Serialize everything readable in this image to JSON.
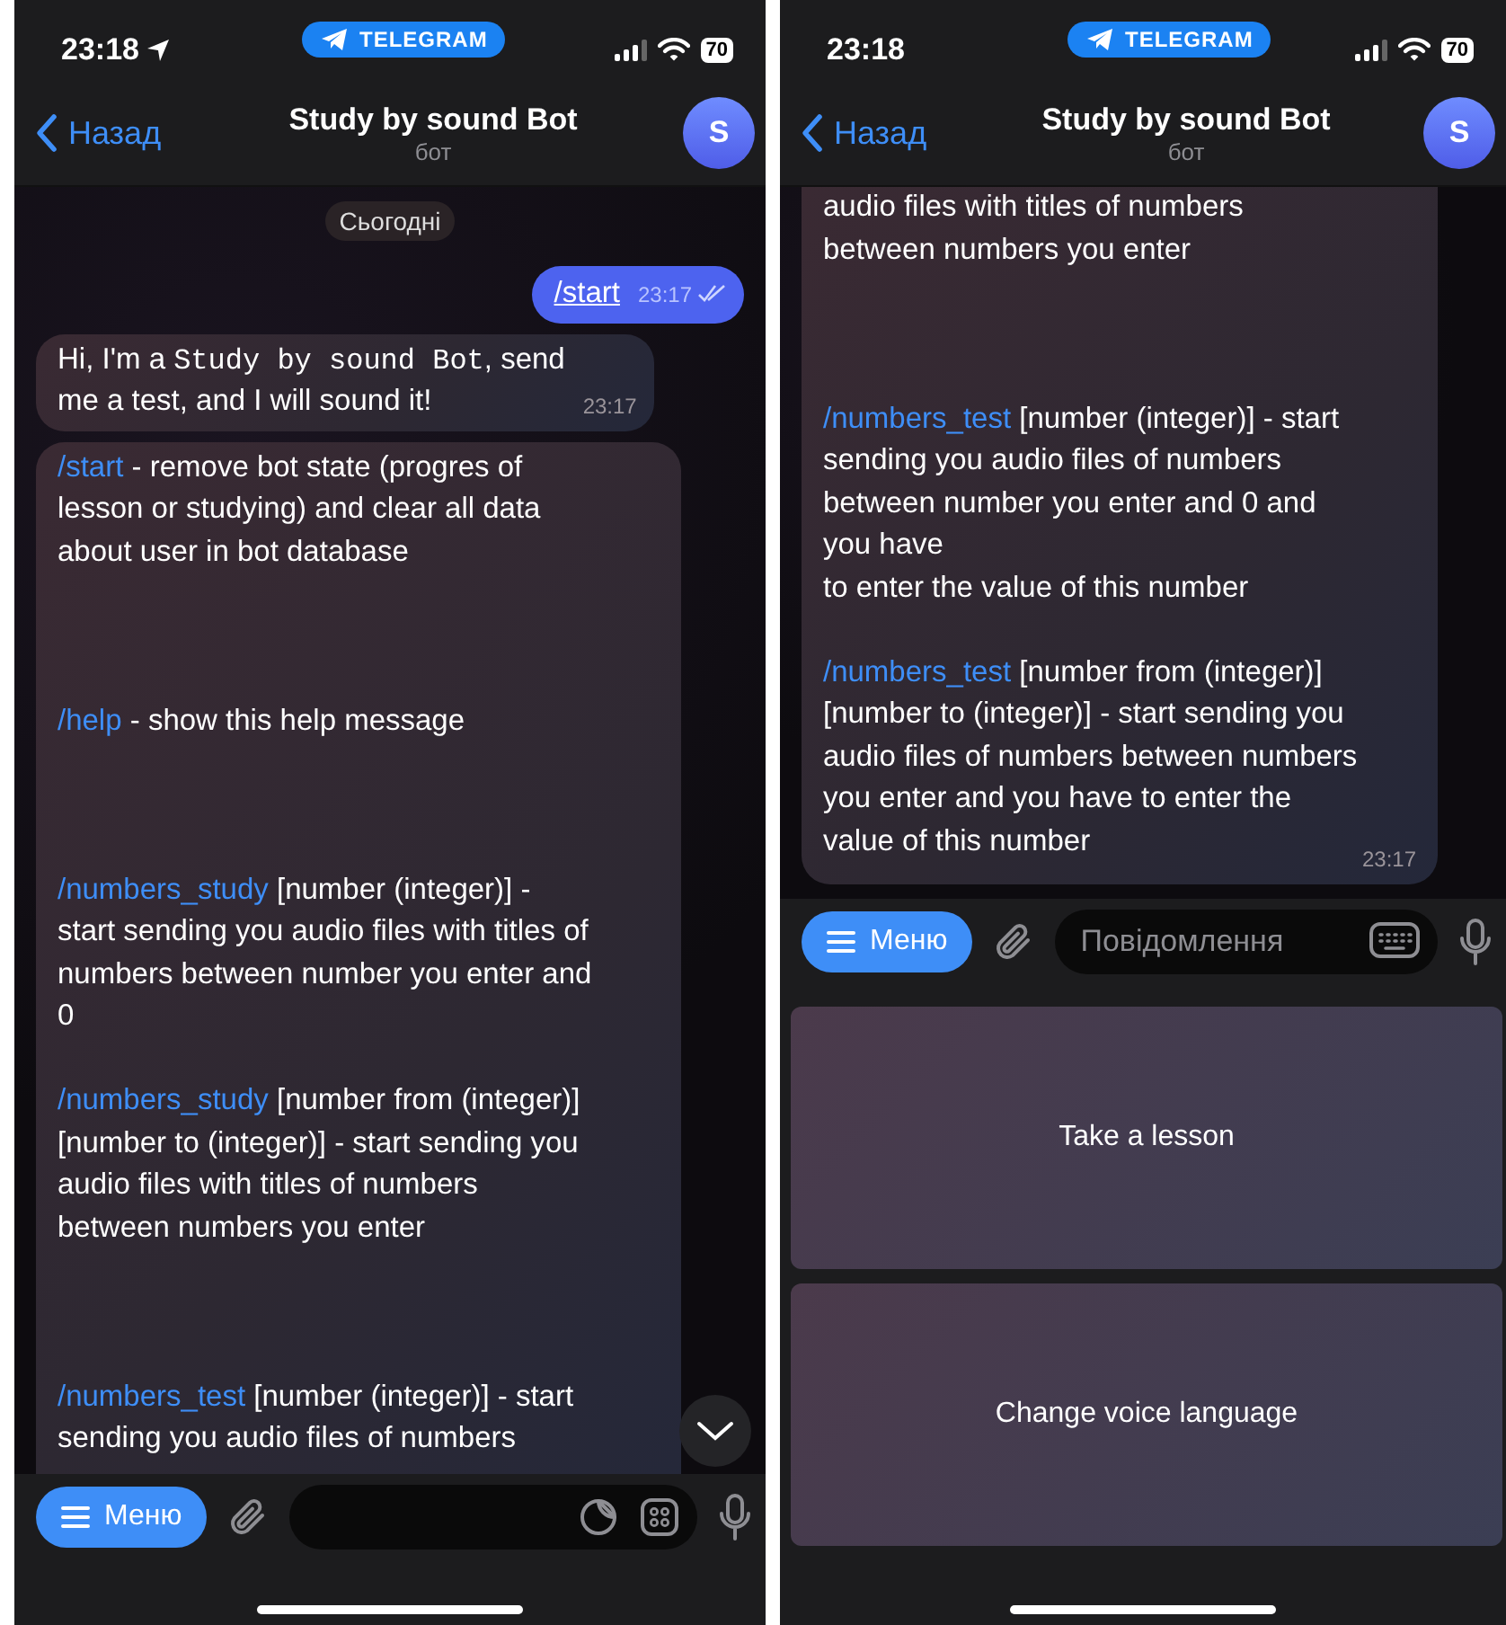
{
  "screens": [
    {
      "status_bar": {
        "time": "23:18",
        "location": true,
        "pill": "TELEGRAM",
        "battery": "70"
      },
      "header": {
        "back": "Назад",
        "title": "Study by sound Bot",
        "subtitle": "бот",
        "avatar": "S"
      },
      "date_badge": "Сьогодні",
      "messages": [
        {
          "kind": "outgoing",
          "segments": [
            {
              "kind": "link",
              "text": "/start"
            }
          ],
          "time": "23:17",
          "read": true
        },
        {
          "kind": "incoming",
          "segments": [
            {
              "kind": "plain",
              "text": "Hi, I'm a "
            },
            {
              "kind": "code",
              "text": "Study by sound Bot"
            },
            {
              "kind": "plain",
              "text": ", send\nme a test, and I will sound it!"
            }
          ],
          "time": "23:17"
        },
        {
          "kind": "incoming",
          "segments": [
            {
              "kind": "command",
              "text": "/start"
            },
            {
              "kind": "plain",
              "text": " - remove bot state (progres of\nlesson or studying) and clear all data\nabout user in bot database\n\n\n\n"
            },
            {
              "kind": "command",
              "text": "/help"
            },
            {
              "kind": "plain",
              "text": " - show this help message\n\n\n\n"
            },
            {
              "kind": "command",
              "text": "/numbers_study"
            },
            {
              "kind": "plain",
              "text": " [number (integer)] -\nstart sending you audio files with titles of\nnumbers between number you enter and\n0\n\n"
            },
            {
              "kind": "command",
              "text": "/numbers_study"
            },
            {
              "kind": "plain",
              "text": " [number from (integer)]\n[number to (integer)] - start sending you\naudio files with titles of numbers\nbetween numbers you enter\n\n\n\n"
            },
            {
              "kind": "command",
              "text": "/numbers_test"
            },
            {
              "kind": "plain",
              "text": " [number (integer)] - start\nsending you audio files of numbers"
            }
          ]
        }
      ],
      "scroll_down": true,
      "input": {
        "menu": "Меню",
        "kind": "stickers"
      }
    },
    {
      "status_bar": {
        "time": "23:18",
        "pill": "TELEGRAM",
        "battery": "70"
      },
      "header": {
        "back": "Назад",
        "title": "Study by sound Bot",
        "subtitle": "бот",
        "avatar": "S"
      },
      "messages": [
        {
          "kind": "continued",
          "segments": [
            {
              "kind": "plain",
              "text": "audio files with titles of numbers\nbetween numbers you enter\n\n\n\n"
            },
            {
              "kind": "command",
              "text": "/numbers_test"
            },
            {
              "kind": "plain",
              "text": " [number (integer)] - start\nsending you audio files of numbers\nbetween number you enter and 0 and\nyou have\nto enter the value of this number\n\n"
            },
            {
              "kind": "command",
              "text": "/numbers_test"
            },
            {
              "kind": "plain",
              "text": " [number from (integer)]\n[number to (integer)] - start sending you\naudio files of numbers between numbers\nyou enter and you have to enter the\nvalue of this number"
            }
          ],
          "time": "23:17"
        }
      ],
      "input": {
        "menu": "Меню",
        "placeholder": "Повідомлення",
        "kind": "keyboard"
      },
      "keyboard_buttons": [
        "Take a lesson",
        "Change voice language"
      ]
    }
  ]
}
